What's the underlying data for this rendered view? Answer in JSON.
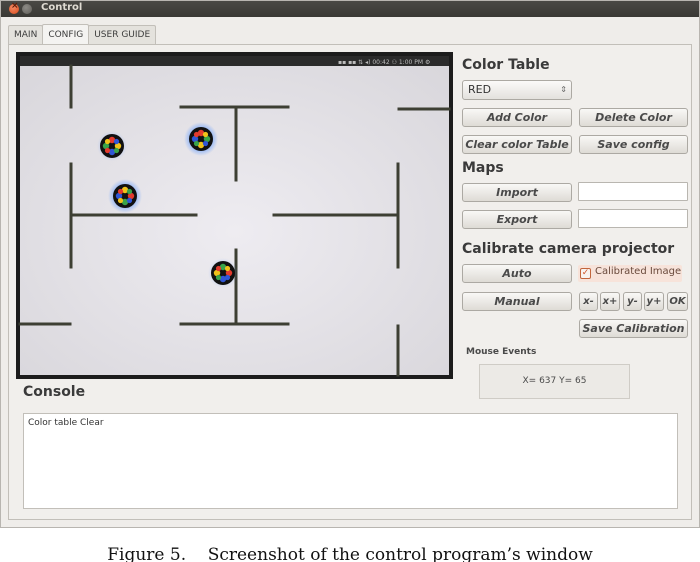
{
  "window": {
    "title": "Control"
  },
  "tabs": [
    {
      "label": "MAIN"
    },
    {
      "label": "CONFIG"
    },
    {
      "label": "USER GUIDE"
    }
  ],
  "camera_status_icons": [
    "▪▪",
    "▪▪",
    "⇅",
    "◂)",
    "00:42",
    "⚇ 1:00 PM",
    "⚙"
  ],
  "color_table": {
    "title": "Color Table",
    "selected": "RED",
    "add_color": "Add Color",
    "delete_color": "Delete Color",
    "clear_table": "Clear color Table",
    "save_config": "Save config"
  },
  "maps": {
    "title": "Maps",
    "import": "Import",
    "export": "Export"
  },
  "calibrate": {
    "title": "Calibrate camera projector",
    "auto": "Auto",
    "manual": "Manual",
    "calibrated_image": "Calibrated Image",
    "calibrated_checked": true,
    "x_minus": "x-",
    "x_plus": "x+",
    "y_minus": "y-",
    "y_plus": "y+",
    "ok": "OK",
    "save_calibration": "Save Calibration"
  },
  "mouse_events": {
    "title": "Mouse Events",
    "readout": "X= 637 Y= 65"
  },
  "console": {
    "title": "Console",
    "text": "Color table Clear"
  },
  "caption": "Figure 5.    Screenshot of the control program’s window",
  "colors": {
    "accent": "#d0562a",
    "maze_floor": "#e5e3e8",
    "maze_wall": "#3d3f33",
    "robot_glow": "#5a8ff0"
  }
}
